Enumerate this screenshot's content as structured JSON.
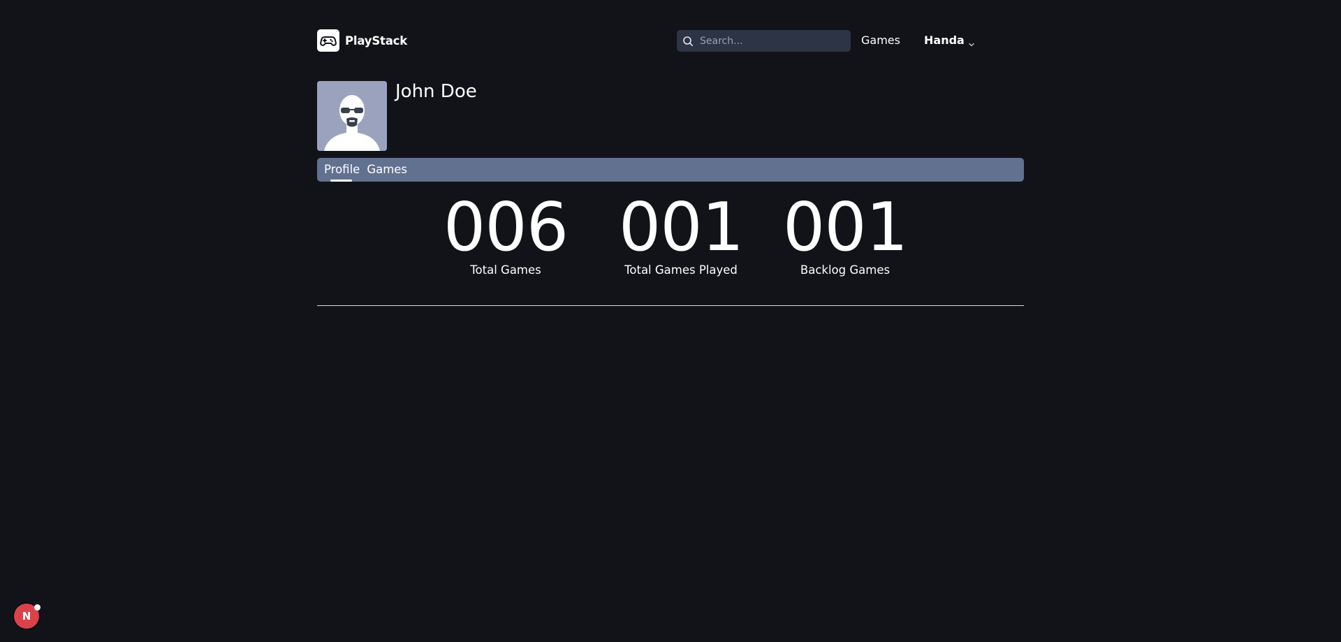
{
  "header": {
    "brand_name": "PlayStack",
    "logo_icon": "gamepad-icon",
    "search_placeholder": "Search...",
    "search_value": "",
    "search_icon": "search-icon",
    "nav_games_label": "Games",
    "user_name": "Handa",
    "user_menu_icon": "chevron-down-icon"
  },
  "profile": {
    "name": "John Doe",
    "avatar_icon": "user-avatar-icon"
  },
  "tabs": [
    {
      "label": "Profile",
      "active": true
    },
    {
      "label": "Games",
      "active": false
    }
  ],
  "stats": [
    {
      "value": "006",
      "label": "Total Games"
    },
    {
      "value": "001",
      "label": "Total Games Played"
    },
    {
      "value": "001",
      "label": "Backlog Games"
    }
  ],
  "dev_badge": {
    "letter": "N",
    "color": "#d9424a"
  },
  "colors": {
    "background": "#121318",
    "tabbar": "#627190",
    "search_bg": "#2c3445",
    "avatar_bg": "#9aa2bd"
  }
}
